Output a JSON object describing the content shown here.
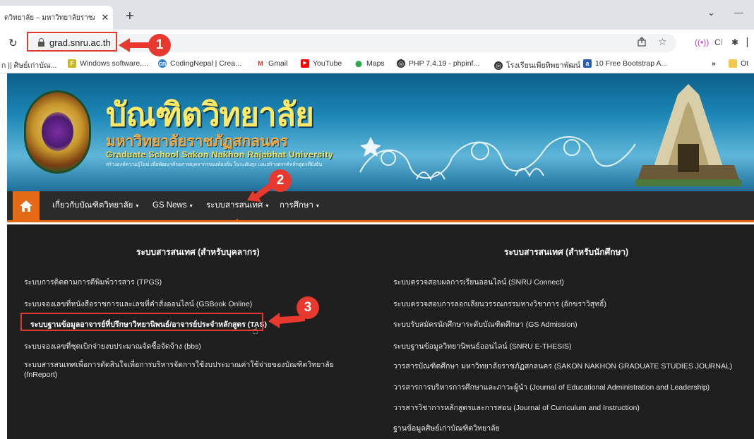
{
  "browser": {
    "tab_title": "ดวิทยาลัย – มหาวิทยาลัยราชภัฏ",
    "tab_close": "✕",
    "new_tab": "+",
    "url": "grad.snru.ac.th",
    "window_minimize": "—",
    "window_chevron": "⌄"
  },
  "bookmarks": [
    {
      "label": "ก || ศิษย์เก่าบัณ...",
      "icon": "page-icon",
      "color": "#888888"
    },
    {
      "label": "Windows software,...",
      "icon": "softpedia-icon",
      "color": "#c9b81d"
    },
    {
      "label": "CodingNepal | Crea...",
      "icon": "codingnepal-icon",
      "color": "#2d7fd1"
    },
    {
      "label": "Gmail",
      "icon": "gmail-icon",
      "color": "#d93025"
    },
    {
      "label": "YouTube",
      "icon": "youtube-icon",
      "color": "#ff0000"
    },
    {
      "label": "Maps",
      "icon": "maps-icon",
      "color": "#34a853"
    },
    {
      "label": "PHP 7.4.19 - phpinf...",
      "icon": "globe-icon",
      "color": "#333333"
    },
    {
      "label": "โรงเรียนเพียทิพยาพัฒน์",
      "icon": "globe-icon",
      "color": "#333333"
    },
    {
      "label": "10 Free Bootstrap A...",
      "icon": "bootstrap-icon",
      "color": "#2a5db0"
    },
    {
      "label": "»",
      "icon": "more-icon",
      "color": "#333333"
    },
    {
      "label": "Ot",
      "icon": "folder-icon",
      "color": "#f2c94c"
    }
  ],
  "site": {
    "title_th": "บัณฑิตวิทยาลัย",
    "subtitle_th": "มหาวิทยาลัยราชภัฏสกลนคร",
    "subtitle_en": "Graduate School Sakon Nakhon Rajabhat University",
    "motto": "สร้างองค์ความรู้ใหม่ เพื่อพัฒนาศักยภาพบุคลากรของท้องถิ่น ในระดับสูง และสร้างสรรค์หลักสูตรที่ยั่งยืน"
  },
  "nav": {
    "items": [
      {
        "label": "เกี่ยวกับบัณฑิตวิทยาลัย",
        "caret": "▾"
      },
      {
        "label": "GS News",
        "caret": "▾"
      },
      {
        "label": "ระบบสารสนเทศ",
        "caret": "▾"
      },
      {
        "label": "การศึกษา",
        "caret": "▾"
      }
    ]
  },
  "menu": {
    "left_heading": "ระบบสารสนเทศ (สำหรับบุคลากร)",
    "right_heading": "ระบบสารสนเทศ (สำหรับนักศึกษา)",
    "left_links": [
      "ระบบการติดตามการตีพิมพ์วารสาร (TPGS)",
      "ระบบจองเลขที่หนังสือราชการและเลขที่คำสั่งออนไลน์ (GSBook Online)",
      "ระบบฐานข้อมูลอาจารย์ที่ปรึกษาวิทยานิพนธ์/อาจารย์ประจำหลักสูตร (TAS)",
      "ระบบจองเลขที่ชุดเบิกจ่ายงบประมาณจัดซื้อจัดจ้าง (bbs)",
      "ระบบสารสนเทศเพื่อการตัดสินใจเพื่อการบริหารจัดการใช้งบประมาณค่าใช้จ่ายของบัณฑิตวิทยาลัย (fnReport)"
    ],
    "right_links": [
      "ระบบตรวจสอบผลการเรียนออนไลน์ (SNRU Connect)",
      "ระบบตรวจสอบการลอกเลียนวรรณกรรมทางวิชาการ (อักขราวิสุทธิ์)",
      "ระบบรับสมัครนักศึกษาระดับบัณฑิตศึกษา (GS Admission)",
      "ระบบฐานข้อมูลวิทยานิพนธ์ออนไลน์ (SNRU E-THESIS)",
      "วารสารบัณฑิตศึกษา มหาวิทยาลัยราชภัฏสกลนคร (SAKON NAKHON GRADUATE STUDIES JOURNAL)",
      "วารสารการบริหารการศึกษาและภาวะผู้นำ (Journal of Educational Administration and Leadership)",
      "วารสารวิชาการหลักสูตรและการสอน (Journal of Curriculum and Instruction)",
      "ฐานข้อมูลศิษย์เก่าบัณฑิตวิทยาลัย"
    ]
  },
  "annotations": {
    "step1": "1",
    "step2": "2",
    "step3": "3",
    "color": "#e8392f"
  },
  "colors": {
    "accent": "#e46a16",
    "nav_bg": "#2b2b2b",
    "menu_bg": "#1f1f1f"
  }
}
